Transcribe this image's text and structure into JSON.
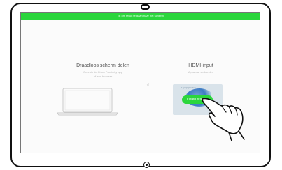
{
  "status_bar": {
    "text": "Tik om terug te gaan naar het scherm"
  },
  "wireless_panel": {
    "title": "Draadloos scherm delen",
    "subtitle_line1": "Gebruik de Cisco Proximity app",
    "subtitle_line2": "of een browser",
    "icon": "laptop-icon"
  },
  "separator": {
    "text": "of"
  },
  "hdmi_panel": {
    "title": "HDMI-input",
    "subtitle": "Apparaat verbonden",
    "preview_text": "Laptop preview",
    "share_button_label": "Delen starten"
  },
  "icons": {
    "hand": "hand-pointer-icon",
    "camera": "camera-icon",
    "home": "home-button-icon"
  },
  "colors": {
    "accent": "#2bd63c"
  }
}
